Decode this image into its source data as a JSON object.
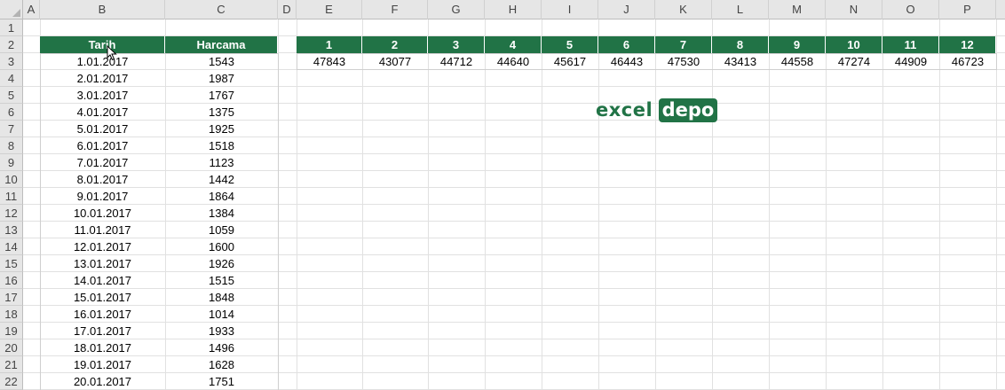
{
  "columns": [
    "A",
    "B",
    "C",
    "D",
    "E",
    "F",
    "G",
    "H",
    "I",
    "J",
    "K",
    "L",
    "M",
    "N",
    "O",
    "P"
  ],
  "rows": [
    "1",
    "2",
    "3",
    "4",
    "5",
    "6",
    "7",
    "8",
    "9",
    "10",
    "11",
    "12",
    "13",
    "14",
    "15",
    "16",
    "17",
    "18",
    "19",
    "20",
    "21",
    "22"
  ],
  "left_table": {
    "headers": [
      "Tarih",
      "Harcama"
    ],
    "dates": [
      "1.01.2017",
      "2.01.2017",
      "3.01.2017",
      "4.01.2017",
      "5.01.2017",
      "6.01.2017",
      "7.01.2017",
      "8.01.2017",
      "9.01.2017",
      "10.01.2017",
      "11.01.2017",
      "12.01.2017",
      "13.01.2017",
      "14.01.2017",
      "15.01.2017",
      "16.01.2017",
      "17.01.2017",
      "18.01.2017",
      "19.01.2017",
      "20.01.2017"
    ],
    "amounts": [
      "1543",
      "1987",
      "1767",
      "1375",
      "1925",
      "1518",
      "1123",
      "1442",
      "1864",
      "1384",
      "1059",
      "1600",
      "1926",
      "1515",
      "1848",
      "1014",
      "1933",
      "1496",
      "1628",
      "1751"
    ]
  },
  "month_table": {
    "headers": [
      "1",
      "2",
      "3",
      "4",
      "5",
      "6",
      "7",
      "8",
      "9",
      "10",
      "11",
      "12"
    ],
    "values": [
      "47843",
      "43077",
      "44712",
      "44640",
      "45617",
      "46443",
      "47530",
      "43413",
      "44558",
      "47274",
      "44909",
      "46723"
    ]
  },
  "logo": {
    "left": "excel",
    "right": "depo"
  },
  "colors": {
    "header_green": "#217346",
    "grid_line": "#e1e1e1",
    "header_bg": "#e6e6e6"
  }
}
